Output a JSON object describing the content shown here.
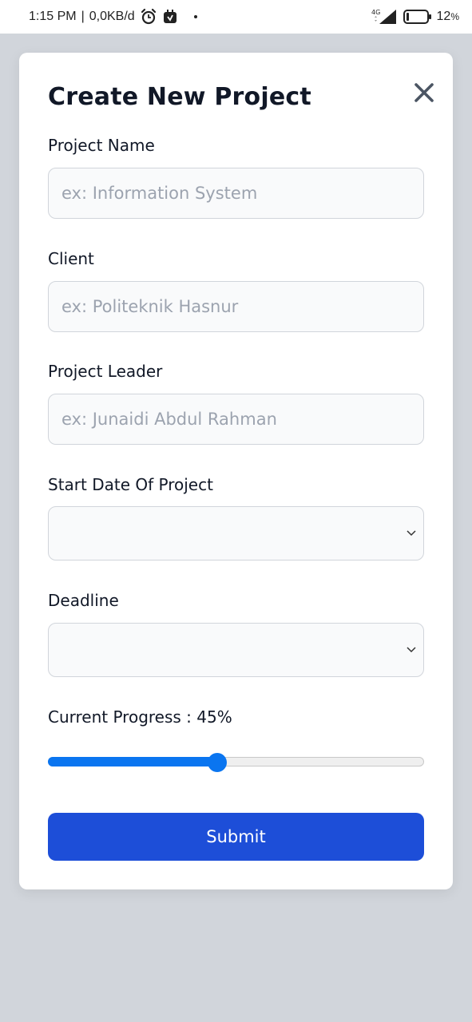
{
  "status_bar": {
    "time": "1:15 PM",
    "separator": "|",
    "speed": "0,0KB/d",
    "network": "4G",
    "battery_percent": "12",
    "battery_unit": "%"
  },
  "modal": {
    "title": "Create New Project",
    "fields": {
      "project_name": {
        "label": "Project Name",
        "placeholder": "ex: Information System",
        "value": ""
      },
      "client": {
        "label": "Client",
        "placeholder": "ex: Politeknik Hasnur",
        "value": ""
      },
      "project_leader": {
        "label": "Project Leader",
        "placeholder": "ex: Junaidi Abdul Rahman",
        "value": ""
      },
      "start_date": {
        "label": "Start Date Of Project",
        "value": ""
      },
      "deadline": {
        "label": "Deadline",
        "value": ""
      }
    },
    "progress": {
      "label": "Current Progress : 45%",
      "value_percent": 45
    },
    "submit_label": "Submit"
  },
  "colors": {
    "accent": "#1d4ed8",
    "slider": "#0a75f0",
    "backdrop": "#d1d5db"
  }
}
